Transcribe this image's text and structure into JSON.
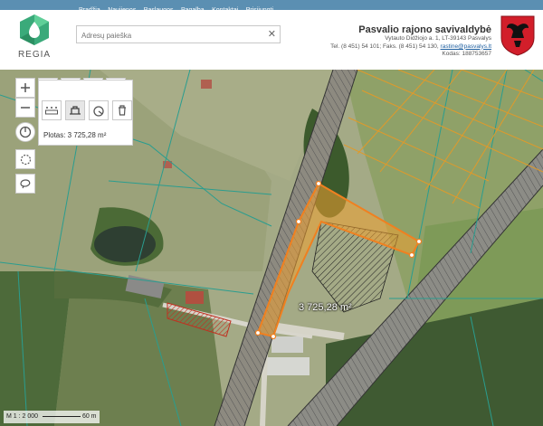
{
  "nav": {
    "items": [
      "Pradžia",
      "Naujienos",
      "Paslaugos",
      "Pagalba",
      "Kontaktai",
      "Prisijungti"
    ]
  },
  "logo": {
    "text": "REGIA"
  },
  "search": {
    "placeholder": "Adresų paieška",
    "value": ""
  },
  "municipality": {
    "name": "Pasvalio rajono savivaldybė",
    "address": "Vytauto Didžiojo a. 1, LT-39143 Pasvalys",
    "phone_prefix": "Tel. (8 451) 54 101; Faks. (8 451) 54 130,",
    "email": "rastine@pasvalys.lt",
    "code": "Kodas: 188753657"
  },
  "map": {
    "area_label": "3 725,28 m²",
    "measure_result": "Plotas: 3 725,28 m²",
    "scale_text": "M 1 : 2 000",
    "scale_bar_text": "60 m"
  },
  "colors": {
    "topnav": "#5b8fb2",
    "measure": "#f0a030",
    "brand": "#3aaa7a"
  }
}
